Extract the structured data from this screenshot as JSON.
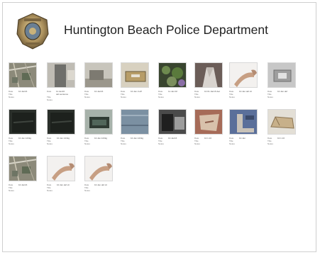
{
  "header": {
    "title": "Huntington Beach Police Department"
  },
  "grid": {
    "rows": [
      {
        "items": [
          {
            "kind": "aerial-map",
            "meta": [
              {
                "label": "Date",
                "value": "10.Jan16"
              },
              {
                "label": "Title",
                "value": ""
              },
              {
                "label": "Notes",
                "value": ""
              }
            ]
          },
          {
            "kind": "doorway",
            "meta": [
              {
                "label": "Date",
                "value": "11.Jan16 def.sentence"
              },
              {
                "label": "Title",
                "value": ""
              },
              {
                "label": "Notes",
                "value": ""
              }
            ]
          },
          {
            "kind": "interior",
            "meta": [
              {
                "label": "Date",
                "value": "10.Jan16"
              },
              {
                "label": "Title",
                "value": ""
              },
              {
                "label": "Notes",
                "value": ""
              }
            ]
          },
          {
            "kind": "package",
            "meta": [
              {
                "label": "Date",
                "value": "10.Jan.3.aff"
              },
              {
                "label": "Title",
                "value": ""
              },
              {
                "label": "Notes",
                "value": ""
              }
            ]
          },
          {
            "kind": "plants",
            "meta": [
              {
                "label": "Date",
                "value": "11.Jan.02"
              },
              {
                "label": "Title",
                "value": ""
              },
              {
                "label": "Notes",
                "value": ""
              }
            ]
          },
          {
            "kind": "fabric",
            "meta": [
              {
                "label": "Date",
                "value": "10.01.Jan16 dec"
              },
              {
                "label": "Title",
                "value": ""
              },
              {
                "label": "Notes",
                "value": ""
              }
            ]
          },
          {
            "kind": "arm",
            "meta": [
              {
                "label": "Date",
                "value": "10.Jan.def.cit"
              },
              {
                "label": "Title",
                "value": ""
              },
              {
                "label": "Notes",
                "value": ""
              }
            ]
          },
          {
            "kind": "panel",
            "meta": [
              {
                "label": "Date",
                "value": "10.Jan.def"
              },
              {
                "label": "Title",
                "value": ""
              },
              {
                "label": "Notes",
                "value": ""
              }
            ]
          }
        ]
      },
      {
        "items": [
          {
            "kind": "dark-cloth",
            "meta": [
              {
                "label": "Date",
                "value": "10.Jan.123kg"
              },
              {
                "label": "Title",
                "value": ""
              },
              {
                "label": "Notes",
                "value": ""
              }
            ]
          },
          {
            "kind": "dark-cloth",
            "meta": [
              {
                "label": "Date",
                "value": "10.Jan.123kg"
              },
              {
                "label": "Title",
                "value": ""
              },
              {
                "label": "Notes",
                "value": ""
              }
            ]
          },
          {
            "kind": "wallet",
            "meta": [
              {
                "label": "Date",
                "value": "10.Jan.123kg"
              },
              {
                "label": "Title",
                "value": ""
              },
              {
                "label": "Notes",
                "value": ""
              }
            ]
          },
          {
            "kind": "denim",
            "meta": [
              {
                "label": "Date",
                "value": "10.Jan.123kg"
              },
              {
                "label": "Title",
                "value": ""
              },
              {
                "label": "Notes",
                "value": ""
              }
            ]
          },
          {
            "kind": "car-interior",
            "meta": [
              {
                "label": "Date",
                "value": "10.Jan16"
              },
              {
                "label": "Title",
                "value": ""
              },
              {
                "label": "Notes",
                "value": ""
              }
            ]
          },
          {
            "kind": "floor",
            "meta": [
              {
                "label": "Date",
                "value": "10.1.10"
              },
              {
                "label": "Title",
                "value": ""
              },
              {
                "label": "Notes",
                "value": ""
              }
            ]
          },
          {
            "kind": "tool",
            "meta": [
              {
                "label": "Date",
                "value": "10.Jan"
              },
              {
                "label": "Title",
                "value": ""
              },
              {
                "label": "Notes",
                "value": ""
              }
            ]
          },
          {
            "kind": "cardboard",
            "meta": [
              {
                "label": "Date",
                "value": "10.1.10"
              },
              {
                "label": "Title",
                "value": ""
              },
              {
                "label": "Notes",
                "value": ""
              }
            ]
          }
        ]
      },
      {
        "items": [
          {
            "kind": "aerial-map",
            "meta": [
              {
                "label": "Date",
                "value": "10.Jan16"
              },
              {
                "label": "Title",
                "value": ""
              },
              {
                "label": "Notes",
                "value": ""
              }
            ]
          },
          {
            "kind": "arm",
            "meta": [
              {
                "label": "Date",
                "value": "10.Jan.def.cit"
              },
              {
                "label": "Title",
                "value": ""
              },
              {
                "label": "Notes",
                "value": ""
              }
            ]
          },
          {
            "kind": "arm",
            "meta": [
              {
                "label": "Date",
                "value": "10.Jan.def.cit"
              },
              {
                "label": "Title",
                "value": ""
              },
              {
                "label": "Notes",
                "value": ""
              }
            ]
          }
        ]
      }
    ]
  }
}
